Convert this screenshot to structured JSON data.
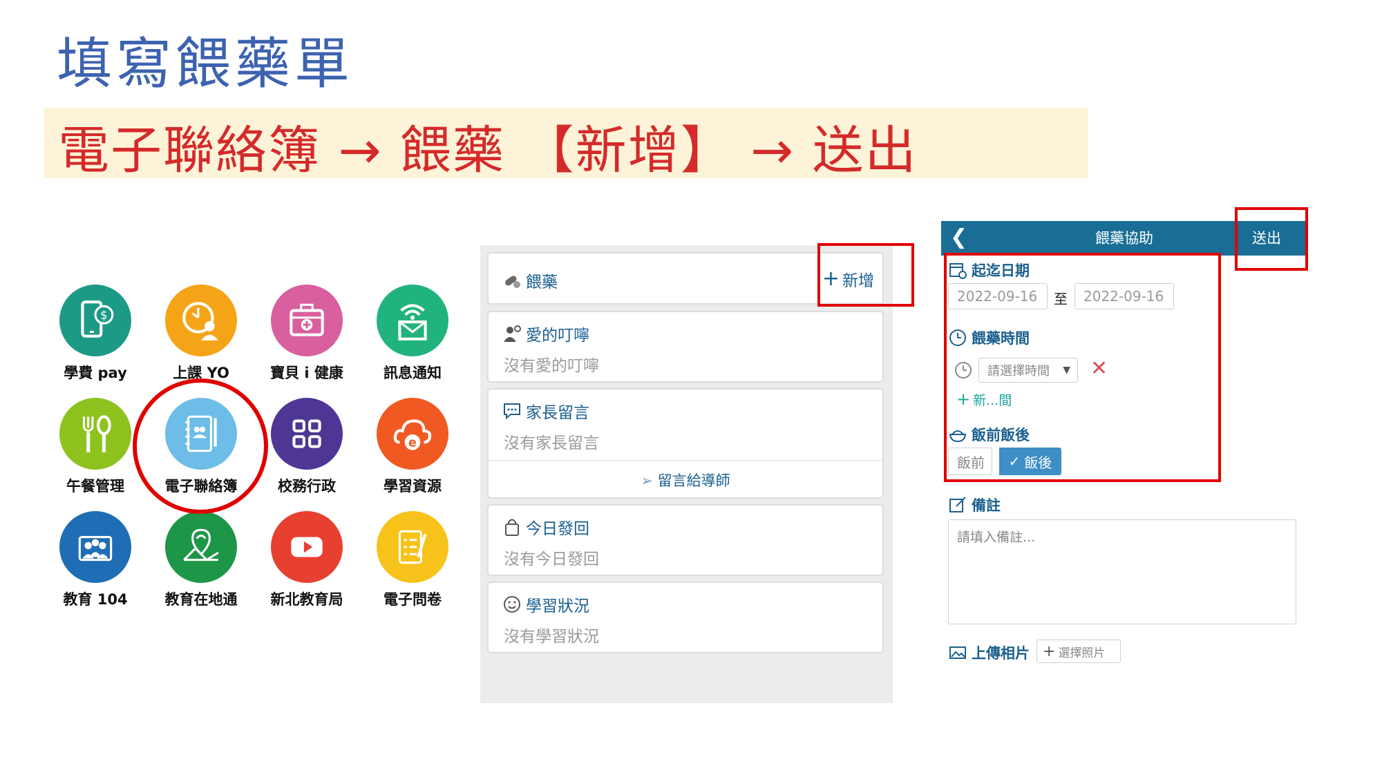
{
  "page_title": "填寫餵藥單",
  "instruction": "電子聯絡簿 → 餵藥 【新增】 → 送出",
  "apps": [
    {
      "label": "學費 pay",
      "icon": "phone-dollar-icon",
      "color": "#1d9a86"
    },
    {
      "label": "上課 YO",
      "icon": "clock-person-icon",
      "color": "#f5a418"
    },
    {
      "label": "寶貝 i 健康",
      "icon": "medical-kit-icon",
      "color": "#d95f9e"
    },
    {
      "label": "訊息通知",
      "icon": "wifi-mail-icon",
      "color": "#21b37d"
    },
    {
      "label": "午餐管理",
      "icon": "fork-spoon-icon",
      "color": "#8ec21f"
    },
    {
      "label": "電子聯絡簿",
      "icon": "notebook-icon",
      "color": "#6dbde8"
    },
    {
      "label": "校務行政",
      "icon": "grid-icon",
      "color": "#4d3694"
    },
    {
      "label": "學習資源",
      "icon": "cloud-e-icon",
      "color": "#f05a22"
    },
    {
      "label": "教育 104",
      "icon": "people-building-icon",
      "color": "#1f6eb5"
    },
    {
      "label": "教育在地通",
      "icon": "map-icon",
      "color": "#1e9647"
    },
    {
      "label": "新北教育局",
      "icon": "youtube-icon",
      "color": "#e84030"
    },
    {
      "label": "電子問卷",
      "icon": "survey-icon",
      "color": "#f7c21a"
    }
  ],
  "middle": {
    "medicine": {
      "title": "餵藥",
      "add": "新增"
    },
    "love": {
      "title": "愛的叮嚀",
      "empty": "沒有愛的叮嚀"
    },
    "parent_msg": {
      "title": "家長留言",
      "empty": "沒有家長留言",
      "action": "留言給導師"
    },
    "today_return": {
      "title": "今日發回",
      "empty": "沒有今日發回"
    },
    "study": {
      "title": "學習狀況",
      "empty": "沒有學習狀況"
    }
  },
  "form": {
    "header_title": "餵藥協助",
    "send": "送出",
    "date_label": "起迄日期",
    "date_from": "2022-09-16",
    "date_to_sep": "至",
    "date_to": "2022-09-16",
    "time_label": "餵藥時間",
    "time_placeholder": "請選擇時間",
    "add_time": "新...間",
    "meal_label": "飯前飯後",
    "meal_before": "飯前",
    "meal_after": "飯後",
    "note_label": "備註",
    "note_placeholder": "請填入備註...",
    "photo_label": "上傳相片",
    "photo_button": "選擇照片"
  }
}
